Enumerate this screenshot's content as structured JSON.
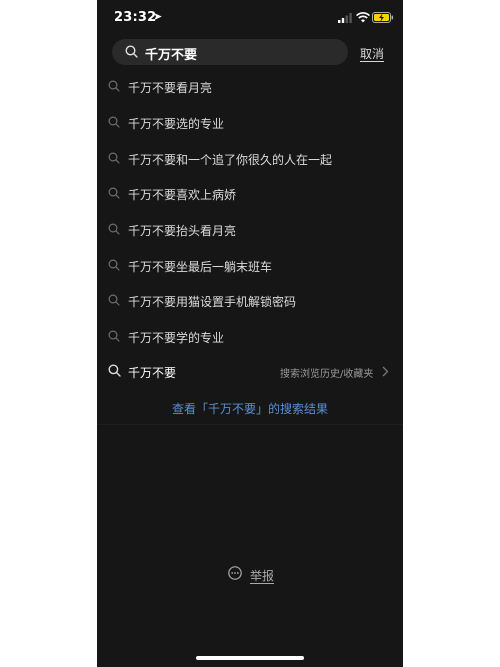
{
  "status_bar": {
    "time": "23:32"
  },
  "search": {
    "query": "千万不要",
    "cancel_label": "取消"
  },
  "suggestions": [
    "千万不要看月亮",
    "千万不要选的专业",
    "千万不要和一个追了你很久的人在一起",
    "千万不要喜欢上病娇",
    "千万不要抬头看月亮",
    "千万不要坐最后一躺末班车",
    "千万不要用猫设置手机解锁密码",
    "千万不要学的专业"
  ],
  "history_row": {
    "label": "千万不要",
    "link": "搜索浏览历史/收藏夹"
  },
  "results_link": "查看「千万不要」的搜索结果",
  "report_label": "举报",
  "colors": {
    "background": "#161616",
    "link": "#5b8fd6",
    "search_field": "#2a2a2a"
  }
}
